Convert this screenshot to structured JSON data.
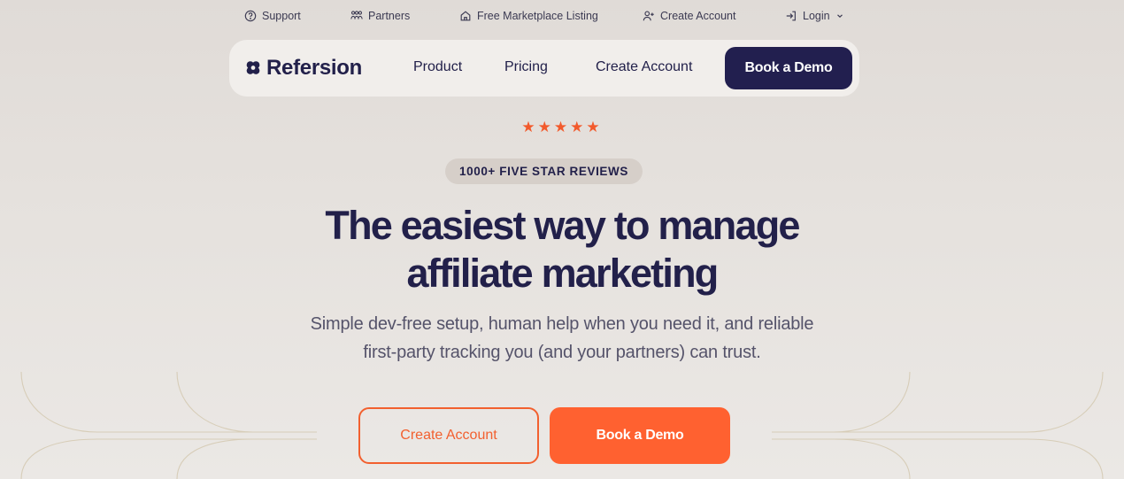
{
  "topbar": {
    "items": [
      {
        "label": "Support",
        "icon": "question-circle-icon"
      },
      {
        "label": "Partners",
        "icon": "partners-icon"
      },
      {
        "label": "Free Marketplace Listing",
        "icon": "home-icon"
      },
      {
        "label": "Create Account",
        "icon": "user-plus-icon"
      },
      {
        "label": "Login",
        "icon": "login-icon"
      }
    ]
  },
  "nav": {
    "logo_text": "Refersion",
    "links": [
      "Product",
      "Pricing",
      "Create Account"
    ],
    "cta_label": "Book a Demo"
  },
  "hero": {
    "stars": "★★★★★",
    "rating_count": 5,
    "badge": "1000+ FIVE STAR REVIEWS",
    "headline_line1": "The easiest way to manage",
    "headline_line2": "affiliate marketing",
    "sub_line1": "Simple dev-free setup, human help when you need it, and reliable",
    "sub_line2": "first-party tracking you (and your partners) can trust.",
    "cta_secondary": "Create Account",
    "cta_primary": "Book a Demo"
  },
  "colors": {
    "brand_navy": "#221f4f",
    "accent_orange": "#ff6130",
    "background": "#e5e1dd"
  }
}
